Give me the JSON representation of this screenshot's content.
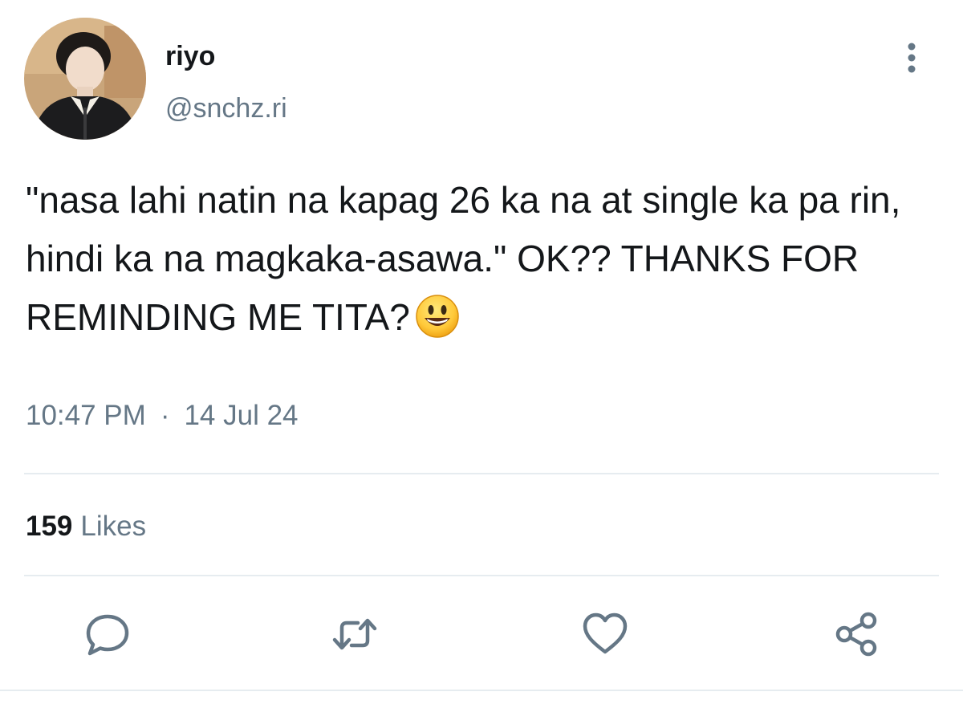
{
  "user": {
    "display_name": "riyo",
    "handle": "@snchz.ri",
    "avatar_icon": "profile-photo"
  },
  "tweet": {
    "text": "\"nasa lahi natin na kapag 26 ka na at single ka pa rin, hindi ka na magkaka-asawa.\" OK?? THANKS FOR REMINDING ME TITA?",
    "emoji": "grinning-face-emoji",
    "time": "10:47 PM",
    "separator": "·",
    "date": "14 Jul 24"
  },
  "stats": {
    "likes_count": "159",
    "likes_label": "Likes"
  },
  "actions": {
    "more_icon": "more-vertical-icon",
    "reply_icon": "reply-icon",
    "retweet_icon": "retweet-icon",
    "like_icon": "heart-icon",
    "share_icon": "share-icon"
  },
  "colors": {
    "text": "#14171a",
    "secondary": "#657786",
    "icon": "#657786",
    "divider": "#e6ecf0"
  }
}
